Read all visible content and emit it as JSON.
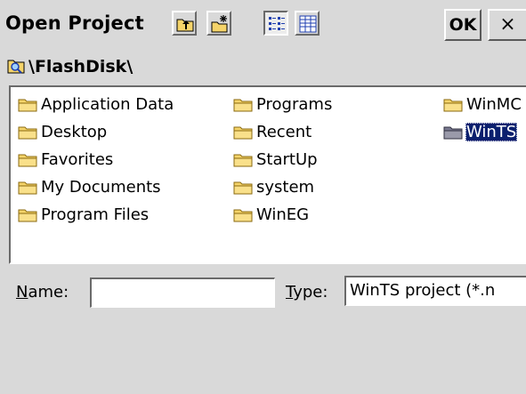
{
  "dialog": {
    "title": "Open Project",
    "ok_label": "OK",
    "close_label": "×"
  },
  "toolbar": {
    "buttons": [
      {
        "name": "up-folder-icon"
      },
      {
        "name": "new-folder-icon"
      },
      {
        "name": "list-view-icon",
        "pressed": true
      },
      {
        "name": "details-view-icon"
      }
    ]
  },
  "path": {
    "icon": "folder-search-icon",
    "text": "\\FlashDisk\\"
  },
  "files": {
    "col1": [
      "Application Data",
      "Desktop",
      "Favorites",
      "My Documents",
      "Program Files"
    ],
    "col2": [
      "Programs",
      "Recent",
      "StartUp",
      "system",
      "WinEG"
    ],
    "col3": [
      "WinMC",
      "WinTS"
    ],
    "selected": "WinTS"
  },
  "form": {
    "name_label_underlined": "N",
    "name_label_rest": "ame:",
    "name_value": "",
    "type_label_underlined": "T",
    "type_label_rest": "ype:",
    "type_value": "WinTS project (*.n"
  },
  "colors": {
    "background": "#d9d9d9",
    "selection": "#0a1f6e",
    "folder": "#f5d46a"
  }
}
